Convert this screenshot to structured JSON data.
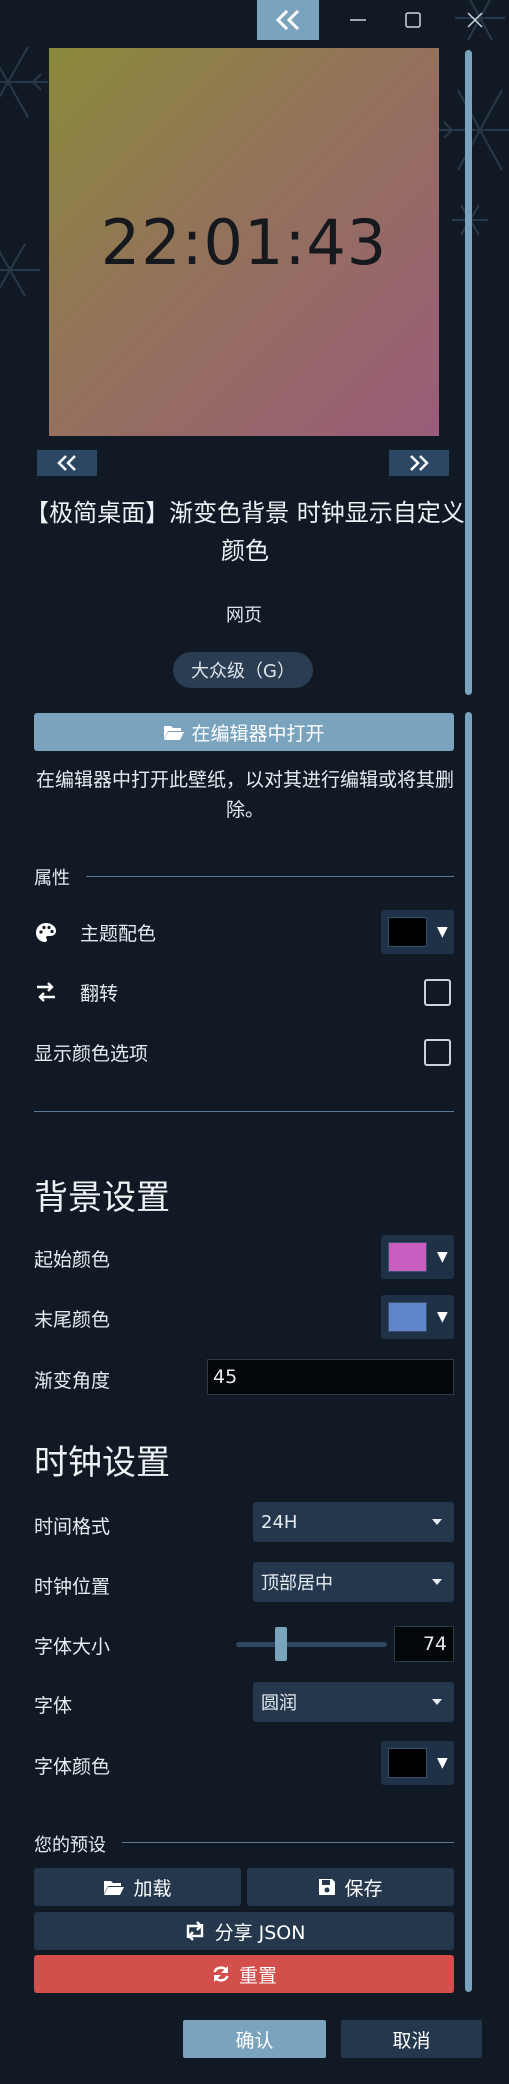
{
  "preview": {
    "clock_text": "22:01:43"
  },
  "wallpaper": {
    "title": "【极简桌面】渐变色背景 时钟显示自定义颜色",
    "type": "网页",
    "rating": "大众级（G）"
  },
  "actions": {
    "open_in_editor": "在编辑器中打开",
    "open_desc": "在编辑器中打开此壁纸，以对其进行编辑或将其删除。"
  },
  "properties": {
    "section_label": "属性",
    "theme_color_label": "主题配色",
    "theme_color_value": "#000000",
    "flip_label": "翻转",
    "show_color_options_label": "显示颜色选项"
  },
  "background": {
    "heading": "背景设置",
    "start_color_label": "起始颜色",
    "start_color_value": "#c95ec2",
    "end_color_label": "末尾颜色",
    "end_color_value": "#5f86c9",
    "gradient_angle_label": "渐变角度",
    "gradient_angle_value": "45"
  },
  "clock": {
    "heading": "时钟设置",
    "time_format_label": "时间格式",
    "time_format_value": "24H",
    "position_label": "时钟位置",
    "position_value": "顶部居中",
    "font_size_label": "字体大小",
    "font_size_value": "74",
    "font_size_fraction": 0.28,
    "font_label": "字体",
    "font_value": "圆润",
    "font_color_label": "字体颜色",
    "font_color_value": "#000000"
  },
  "presets": {
    "section_label": "您的预设",
    "load": "加载",
    "save": "保存",
    "share": "分享 JSON",
    "reset": "重置"
  },
  "dialog": {
    "ok": "确认",
    "cancel": "取消"
  },
  "colors": {
    "accent": "#7aa3bd",
    "danger": "#d24f4c",
    "panel": "#24374d",
    "background": "#111a24"
  }
}
